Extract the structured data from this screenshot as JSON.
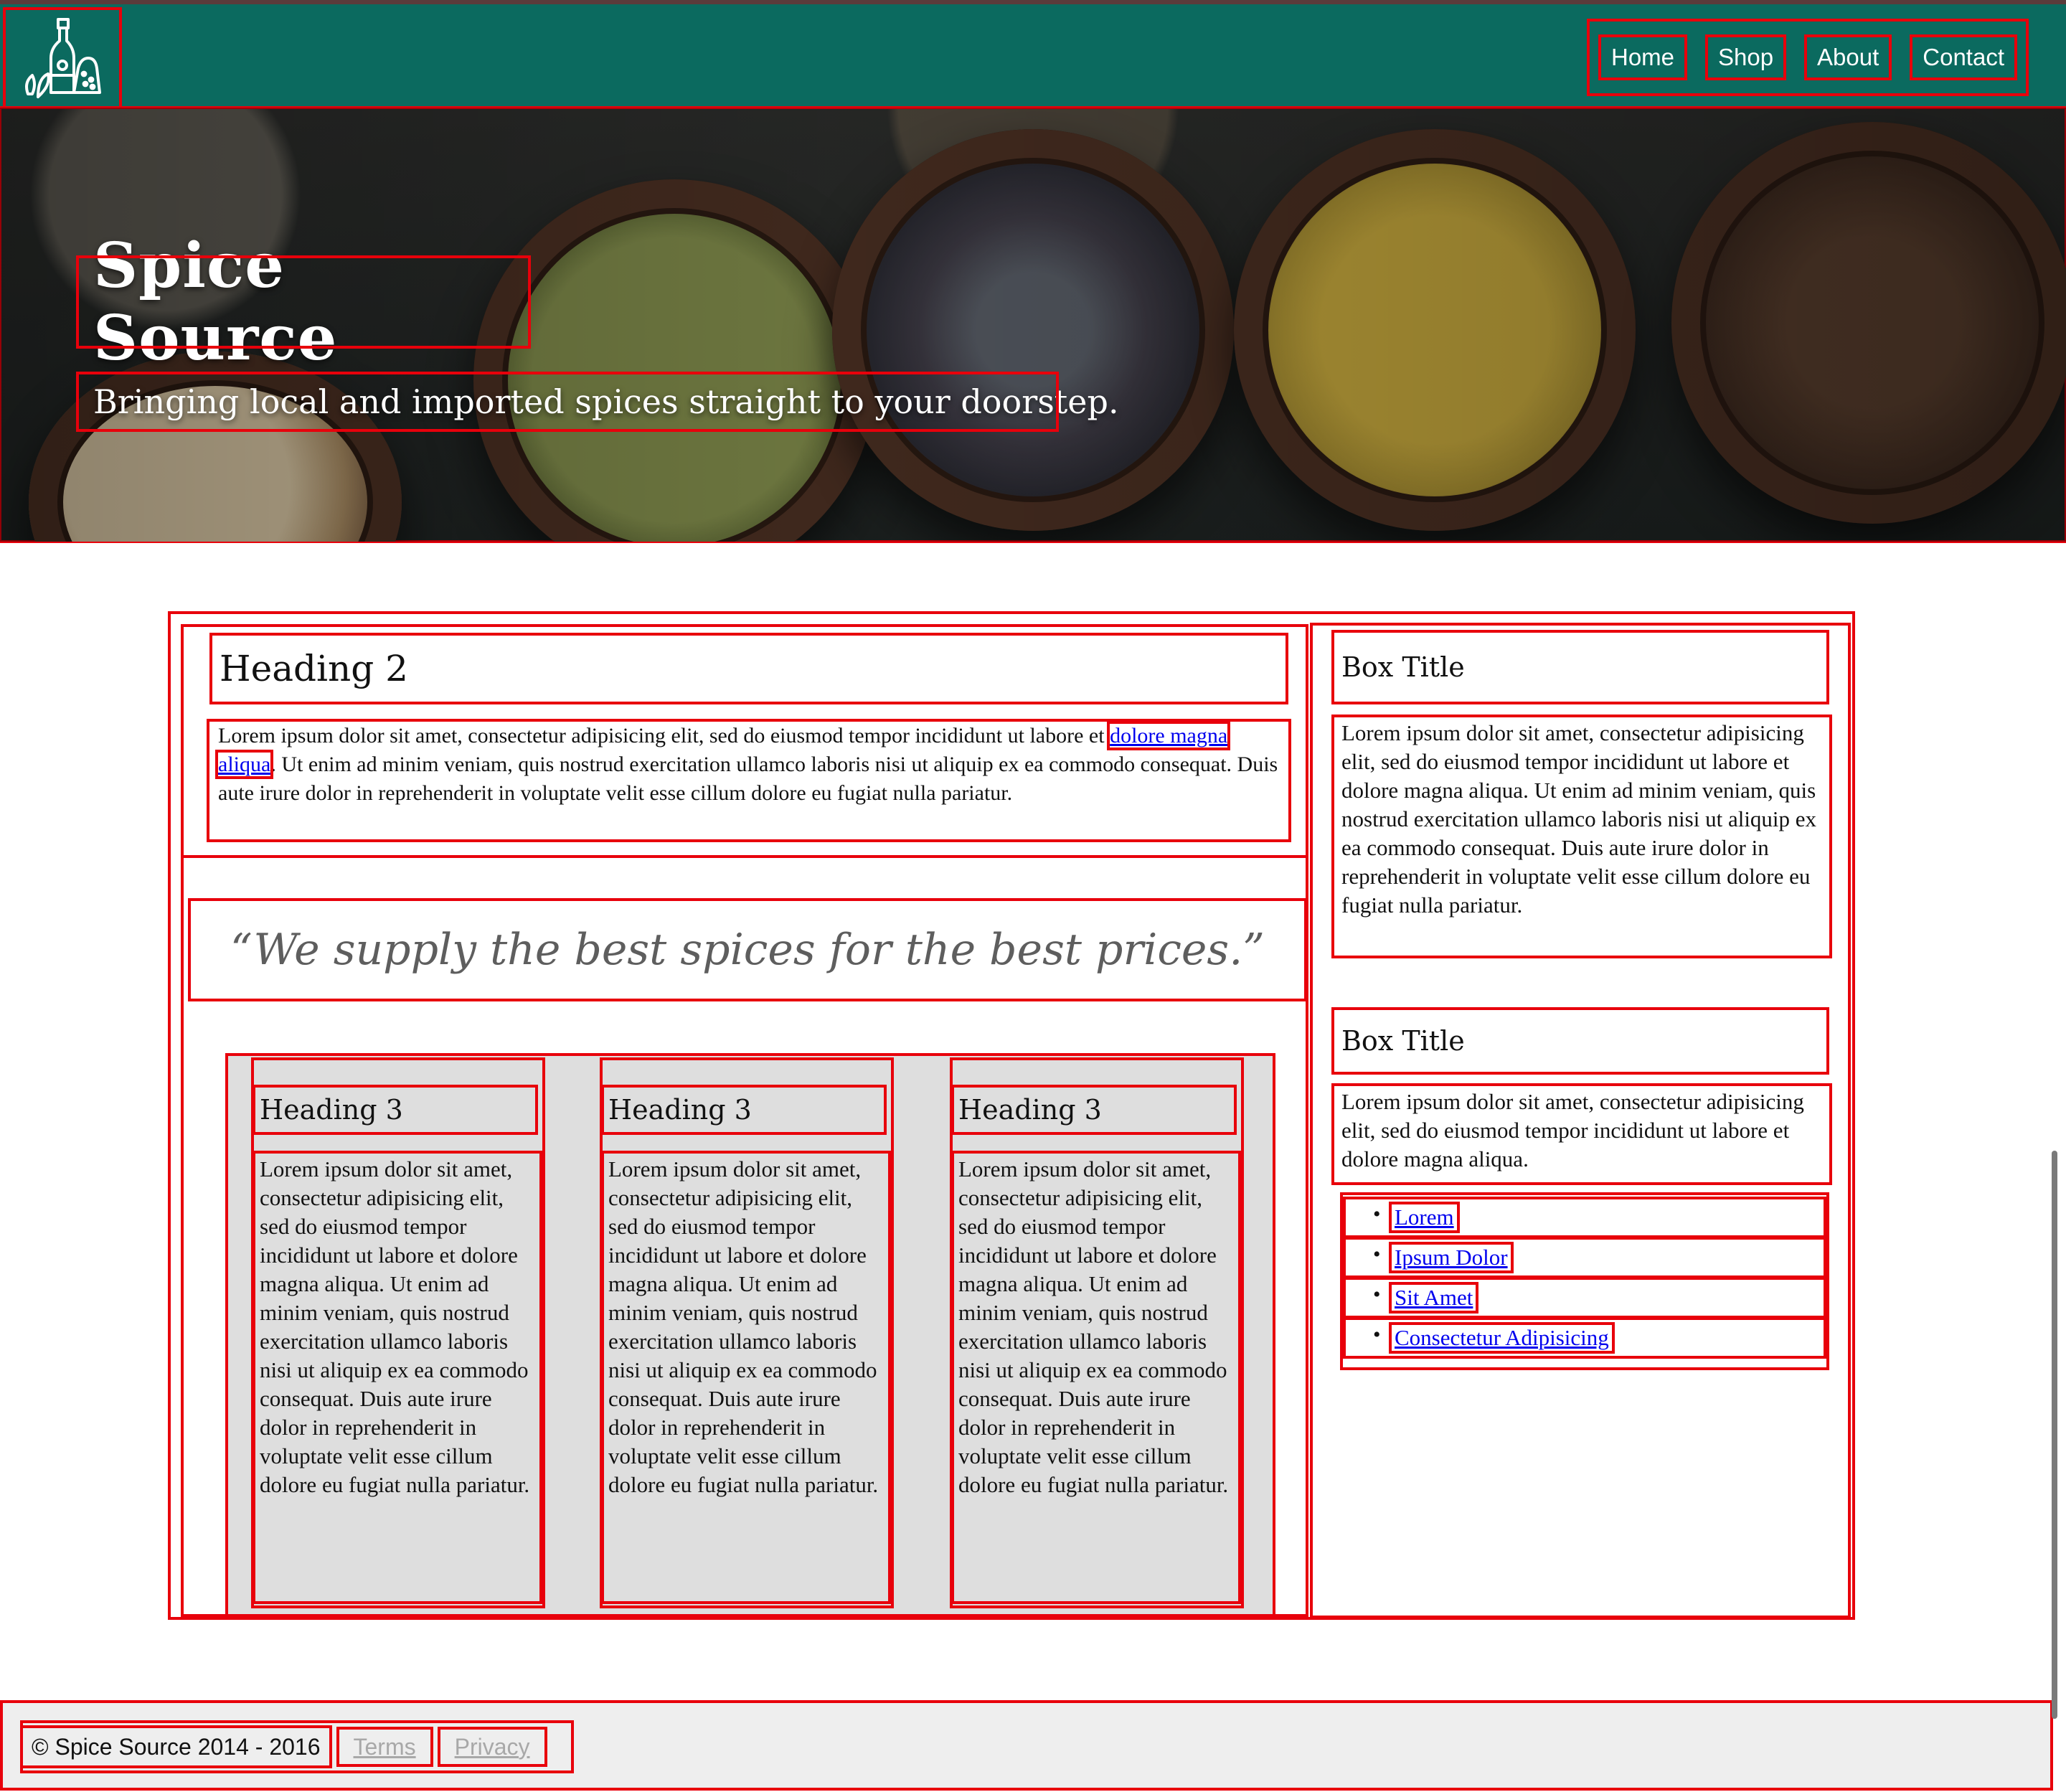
{
  "nav": {
    "items": [
      {
        "label": "Home"
      },
      {
        "label": "Shop"
      },
      {
        "label": "About"
      },
      {
        "label": "Contact"
      }
    ]
  },
  "hero": {
    "title": "Spice Source",
    "subtitle": "Bringing local and imported spices straight to your doorstep."
  },
  "intro": {
    "heading": "Heading 2",
    "text_before": "Lorem ipsum dolor sit amet, consectetur adipisicing elit, sed do eiusmod tempor incididunt ut labore et ",
    "link": "dolore magna aliqua",
    "text_after": ". Ut enim ad minim veniam, quis nostrud exercitation ullamco laboris nisi ut aliquip ex ea commodo consequat. Duis aute irure dolor in reprehenderit in voluptate velit esse cillum dolore eu fugiat nulla pariatur."
  },
  "quote": "“We supply the best spices for the best prices.”",
  "columns": [
    {
      "heading": "Heading 3",
      "text": "Lorem ipsum dolor sit amet, consectetur adipisicing elit, sed do eiusmod tempor incididunt ut labore et dolore magna aliqua. Ut enim ad minim veniam, quis nostrud exercitation ullamco laboris nisi ut aliquip ex ea commodo consequat. Duis aute irure dolor in reprehenderit in voluptate velit esse cillum dolore eu fugiat nulla pariatur."
    },
    {
      "heading": "Heading 3",
      "text": "Lorem ipsum dolor sit amet, consectetur adipisicing elit, sed do eiusmod tempor incididunt ut labore et dolore magna aliqua. Ut enim ad minim veniam, quis nostrud exercitation ullamco laboris nisi ut aliquip ex ea commodo consequat. Duis aute irure dolor in reprehenderit in voluptate velit esse cillum dolore eu fugiat nulla pariatur."
    },
    {
      "heading": "Heading 3",
      "text": "Lorem ipsum dolor sit amet, consectetur adipisicing elit, sed do eiusmod tempor incididunt ut labore et dolore magna aliqua. Ut enim ad minim veniam, quis nostrud exercitation ullamco laboris nisi ut aliquip ex ea commodo consequat. Duis aute irure dolor in reprehenderit in voluptate velit esse cillum dolore eu fugiat nulla pariatur."
    }
  ],
  "sidebar": {
    "box1": {
      "title": "Box Title",
      "text": "Lorem ipsum dolor sit amet, consectetur adipisicing elit, sed do eiusmod tempor incididunt ut labore et dolore magna aliqua. Ut enim ad minim veniam, quis nostrud exercitation ullamco laboris nisi ut aliquip ex ea commodo consequat. Duis aute irure dolor in reprehenderit in voluptate velit esse cillum dolore eu fugiat nulla pariatur."
    },
    "box2": {
      "title": "Box Title",
      "text": "Lorem ipsum dolor sit amet, consectetur adipisicing elit, sed do eiusmod tempor incididunt ut labore et dolore magna aliqua."
    },
    "links": [
      {
        "label": "Lorem"
      },
      {
        "label": "Ipsum Dolor"
      },
      {
        "label": "Sit Amet"
      },
      {
        "label": "Consectetur Adipisicing"
      }
    ]
  },
  "footer": {
    "copyright": "© Spice Source 2014 - 2016",
    "terms": "Terms",
    "privacy": "Privacy"
  },
  "colors": {
    "header_bg": "#0b6a5f",
    "debug_outline": "#e8000b",
    "link": "#0000ee",
    "footer_bg": "#eeeeee",
    "columns_bg": "#dedede"
  },
  "icons": {
    "logo": "spice-bottle-logo-icon"
  }
}
